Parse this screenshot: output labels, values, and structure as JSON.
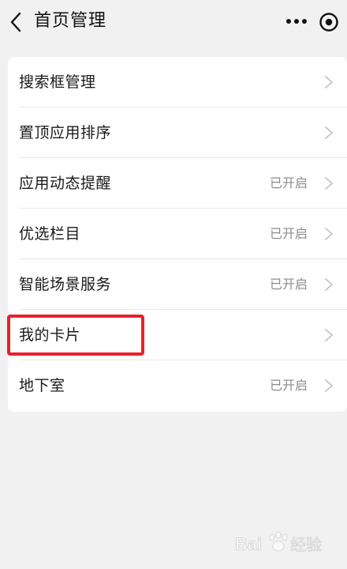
{
  "navbar": {
    "title": "首页管理",
    "back_icon": "chevron-left-icon",
    "more_icon": "more-dots-icon",
    "target_icon": "target-circle-icon"
  },
  "menu": {
    "items": [
      {
        "label": "搜索框管理",
        "status": ""
      },
      {
        "label": "置顶应用排序",
        "status": ""
      },
      {
        "label": "应用动态提醒",
        "status": "已开启"
      },
      {
        "label": "优选栏目",
        "status": "已开启"
      },
      {
        "label": "智能场景服务",
        "status": "已开启"
      },
      {
        "label": "我的卡片",
        "status": ""
      },
      {
        "label": "地下室",
        "status": "已开启"
      }
    ]
  },
  "annotation": {
    "highlighted_item": "我的卡片",
    "highlight_color": "#e8212a"
  },
  "watermark": {
    "text": "Baidu经验"
  },
  "colors": {
    "background": "#f1f1f1",
    "card": "#ffffff",
    "status_text": "#8c8c8c",
    "chevron": "#c4c4c4"
  }
}
